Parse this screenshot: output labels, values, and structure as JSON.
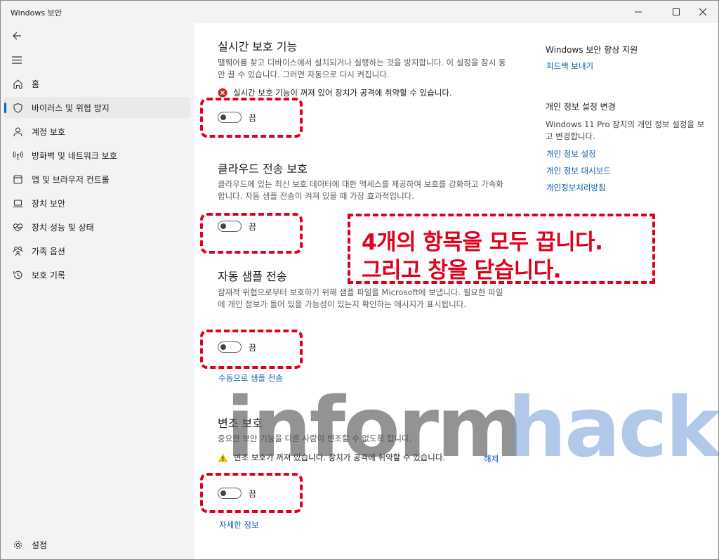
{
  "window": {
    "title": "Windows 보안"
  },
  "sidebar": {
    "items": [
      {
        "label": "홈",
        "icon": "home-icon"
      },
      {
        "label": "바이러스 및 위협 방지",
        "icon": "shield-icon",
        "active": true
      },
      {
        "label": "계정 보호",
        "icon": "person-icon"
      },
      {
        "label": "방화벽 및 네트워크 보호",
        "icon": "antenna-icon"
      },
      {
        "label": "앱 및 브라우저 컨트롤",
        "icon": "app-window-icon"
      },
      {
        "label": "장치 보안",
        "icon": "laptop-icon"
      },
      {
        "label": "장치 성능 및 상태",
        "icon": "heart-pulse-icon"
      },
      {
        "label": "가족 옵션",
        "icon": "family-icon"
      },
      {
        "label": "보호 기록",
        "icon": "history-icon"
      }
    ],
    "settings_label": "설정"
  },
  "sections": {
    "realtime": {
      "title": "실시간 보호 기능",
      "desc": "맬웨어를 찾고 디바이스에서 설치되거나 실행하는 것을 방지합니다. 이 설정을 잠시 동안 끌 수 있습니다. 그러면 자동으로 다시 켜집니다.",
      "alert": "실시간 보호 기능이 꺼져 있어 장치가 공격에 취약할 수 있습니다.",
      "toggle_label": "끔"
    },
    "cloud": {
      "title": "클라우드 전송 보호",
      "desc": "클라우드에 있는 최신 보호 데이터에 대한 액세스를 제공하여 보호를 강화하고 가속화합니다. 자동 샘플 전송이 켜져 있을 때 가장 효과적입니다.",
      "toggle_label": "끔"
    },
    "sample": {
      "title": "자동 샘플 전송",
      "desc": "잠재적 위협으로부터 보호하기 위해 샘플 파일을 Microsoft에 보냅니다. 필요한 파일에 개인 정보가 들어 있을 가능성이 있는지 확인하는 메시지가 표시됩니다.",
      "toggle_label": "끔",
      "link": "수동으로 샘플 전송"
    },
    "tamper": {
      "title": "변조 보호",
      "desc": "중요한 보안 기능을 다른 사람이 변조할 수 없도록 합니다.",
      "alert": "변조 보호가 꺼져 있습니다. 장치가 공격에 취약할 수 있습니다.",
      "dismiss": "해제",
      "toggle_label": "끔",
      "link": "자세한 정보"
    }
  },
  "right_panel": {
    "improve_title": "Windows 보안 향상 지원",
    "feedback_link": "피드백 보내기",
    "privacy_title": "개인 정보 설정 변경",
    "privacy_desc": "Windows 11 Pro 장치의 개인 정보 설정을 보고 변경합니다.",
    "links": [
      "개인 정보 설정",
      "개인 정보 대시보드",
      "개인정보처리방침"
    ]
  },
  "annotation": {
    "line1": "4개의 항목을 모두 끕니다.",
    "line2": "그리고 창을 닫습니다."
  },
  "watermark": {
    "part1": "inform",
    "part2": "hack"
  },
  "colors": {
    "accent": "#0067c0",
    "link": "#0b5cad",
    "annotation": "#e0001a",
    "error": "#c42b1c",
    "warning": "#f2c200"
  }
}
